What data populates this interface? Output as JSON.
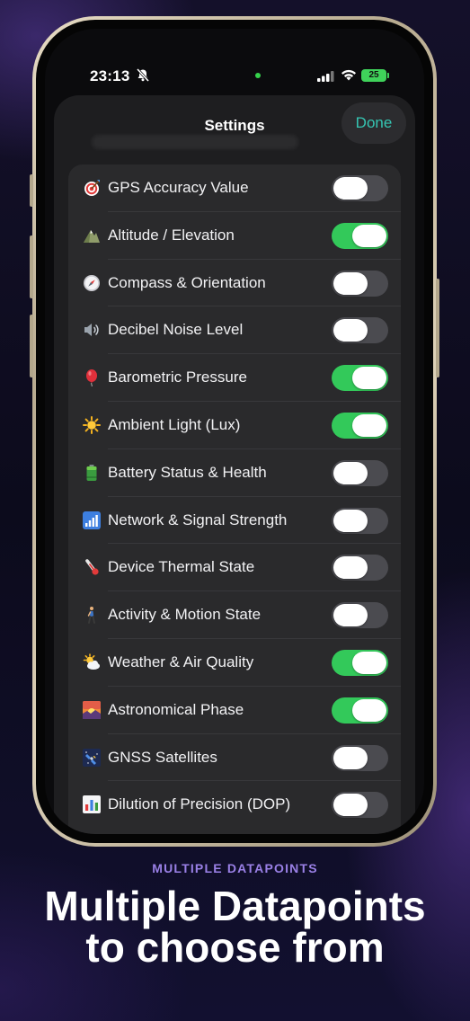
{
  "status_bar": {
    "time": "23:13",
    "battery": "25"
  },
  "sheet": {
    "title": "Settings",
    "done_label": "Done"
  },
  "items": [
    {
      "label": "GPS Accuracy Value",
      "icon": "target-icon",
      "on": false
    },
    {
      "label": "Altitude / Elevation",
      "icon": "mountain-icon",
      "on": true
    },
    {
      "label": "Compass & Orientation",
      "icon": "compass-icon",
      "on": false
    },
    {
      "label": "Decibel Noise Level",
      "icon": "speaker-icon",
      "on": false
    },
    {
      "label": "Barometric Pressure",
      "icon": "balloon-icon",
      "on": true
    },
    {
      "label": "Ambient Light (Lux)",
      "icon": "sun-icon",
      "on": true
    },
    {
      "label": "Battery Status & Health",
      "icon": "battery-icon",
      "on": false
    },
    {
      "label": "Network & Signal Strength",
      "icon": "signal-bars-icon",
      "on": false
    },
    {
      "label": "Device Thermal State",
      "icon": "thermometer-icon",
      "on": false
    },
    {
      "label": "Activity & Motion State",
      "icon": "walking-person-icon",
      "on": false
    },
    {
      "label": "Weather & Air Quality",
      "icon": "sun-cloud-icon",
      "on": true
    },
    {
      "label": "Astronomical Phase",
      "icon": "sunrise-icon",
      "on": true
    },
    {
      "label": "GNSS Satellites",
      "icon": "satellite-icon",
      "on": false
    },
    {
      "label": "Dilution of Precision (DOP)",
      "icon": "bar-chart-icon",
      "on": false
    }
  ],
  "footer": {
    "kicker": "MULTIPLE DATAPOINTS",
    "headline_line1": "Multiple Datapoints",
    "headline_line2": "to choose from"
  },
  "colors": {
    "toggle_on": "#33c95a",
    "toggle_off": "#4b4b50",
    "accent": "#35c6b3",
    "kicker": "#9a80e6"
  }
}
